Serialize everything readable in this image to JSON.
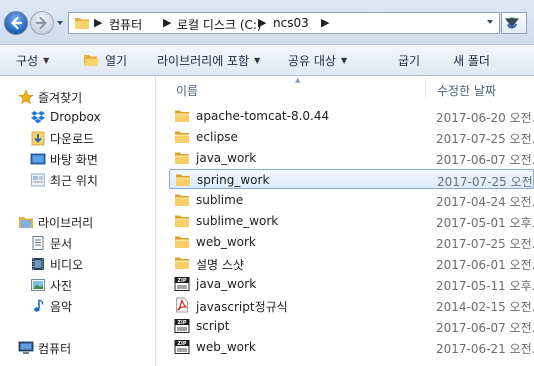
{
  "address_bar": {
    "crumbs": [
      "컴퓨터",
      "로컬 디스크 (C:)",
      "ncs03"
    ]
  },
  "toolbar": {
    "organize": "구성",
    "open": "열기",
    "include_library": "라이브러리에 포함",
    "share_with": "공유 대상",
    "burn": "굽기",
    "new_folder": "새 폴더"
  },
  "nav_pane": {
    "favorites": {
      "label": "즐겨찾기",
      "items": [
        "Dropbox",
        "다운로드",
        "바탕 화면",
        "최근 위치"
      ]
    },
    "libraries": {
      "label": "라이브러리",
      "items": [
        "문서",
        "비디오",
        "사진",
        "음악"
      ]
    },
    "computer": {
      "label": "컴퓨터"
    }
  },
  "columns": {
    "name": "이름",
    "date_modified": "수정한 날짜"
  },
  "files": [
    {
      "name": "apache-tomcat-8.0.44",
      "date": "2017-06-20 오전...",
      "type": "folder"
    },
    {
      "name": "eclipse",
      "date": "2017-07-25 오전...",
      "type": "folder"
    },
    {
      "name": "java_work",
      "date": "2017-06-07 오전...",
      "type": "folder"
    },
    {
      "name": "spring_work",
      "date": "2017-07-25 오전...",
      "type": "folder",
      "selected": true
    },
    {
      "name": "sublime",
      "date": "2017-04-24 오전...",
      "type": "folder"
    },
    {
      "name": "sublime_work",
      "date": "2017-05-01 오후...",
      "type": "folder"
    },
    {
      "name": "web_work",
      "date": "2017-07-25 오전...",
      "type": "folder"
    },
    {
      "name": "설명 스샷",
      "date": "2017-06-01 오전...",
      "type": "folder"
    },
    {
      "name": "java_work",
      "date": "2017-05-11 오후...",
      "type": "zip"
    },
    {
      "name": "javascript정규식",
      "date": "2014-02-15 오전...",
      "type": "pdf"
    },
    {
      "name": "script",
      "date": "2017-06-07 오전...",
      "type": "zip"
    },
    {
      "name": "web_work",
      "date": "2017-06-21 오전...",
      "type": "zip"
    }
  ],
  "colors": {
    "selection_border": "#84acdd",
    "folder_yellow": "#f3c74f",
    "accent_blue": "#1e5fb8"
  }
}
